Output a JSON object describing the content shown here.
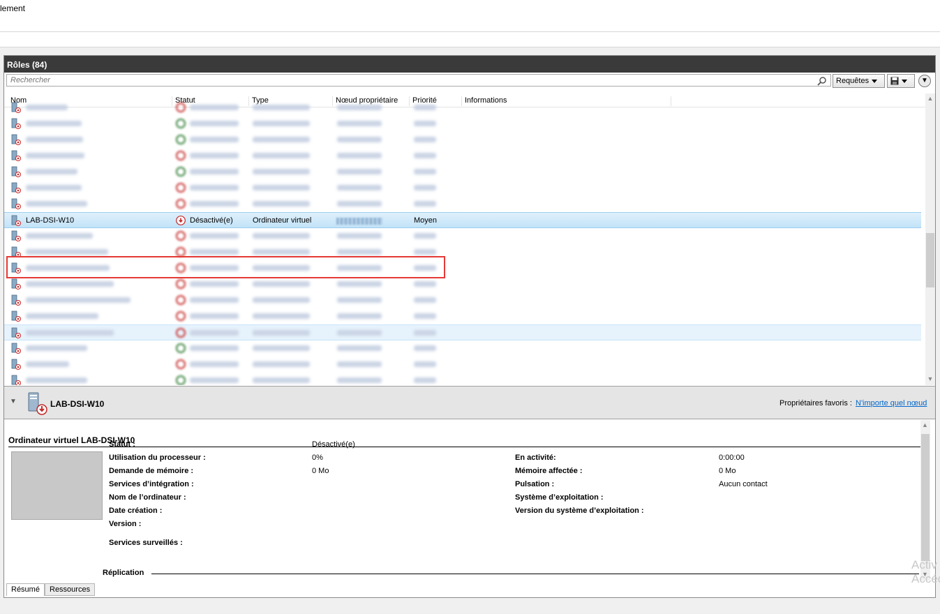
{
  "window": {
    "title_partial": "lement"
  },
  "panel": {
    "title": "Rôles (84)",
    "search_placeholder": "Rechercher",
    "queries_label": "Requêtes"
  },
  "columns": [
    "Nom",
    "Statut",
    "Type",
    "Nœud propriétaire",
    "Priorité",
    "Informations"
  ],
  "rows_blurred_count": 17,
  "selected_row": {
    "name": "LAB-DSI-W10",
    "status": "Désactivé(e)",
    "type": "Ordinateur virtuel",
    "priority": "Moyen"
  },
  "details": {
    "header_name": "LAB-DSI-W10",
    "fav_label": "Propriétaires favoris :",
    "fav_link": "N'importe quel nœud",
    "vm_title": "Ordinateur virtuel LAB-DSI-W10",
    "left": [
      {
        "label": "Statut :",
        "value": "Désactivé(e)"
      },
      {
        "label": "Utilisation du processeur :",
        "value": "0%"
      },
      {
        "label": "Demande de mémoire :",
        "value": "0 Mo"
      },
      {
        "label": "Services d’intégration :",
        "value": ""
      },
      {
        "label": "Nom de l’ordinateur :",
        "value": ""
      },
      {
        "label": "Date création :",
        "value": ""
      },
      {
        "label": "Version :",
        "value": ""
      },
      {
        "label": "Services surveillés :",
        "value": ""
      }
    ],
    "right": [
      {
        "label": "En activité:",
        "value": "0:00:00"
      },
      {
        "label": "Mémoire affectée :",
        "value": "0 Mo"
      },
      {
        "label": "Pulsation :",
        "value": "Aucun contact"
      },
      {
        "label": "Système d’exploitation :",
        "value": ""
      },
      {
        "label": "Version du système d’exploitation :",
        "value": ""
      }
    ],
    "replication_label": "Réplication"
  },
  "tabs": [
    "Résumé",
    "Ressources"
  ],
  "watermark": [
    "Activ",
    "Accéd"
  ],
  "colors": {
    "header_bg": "#3a3a3a",
    "selection": "#c2e3f8",
    "highlight_box": "#e53935",
    "link": "#0066cc"
  }
}
